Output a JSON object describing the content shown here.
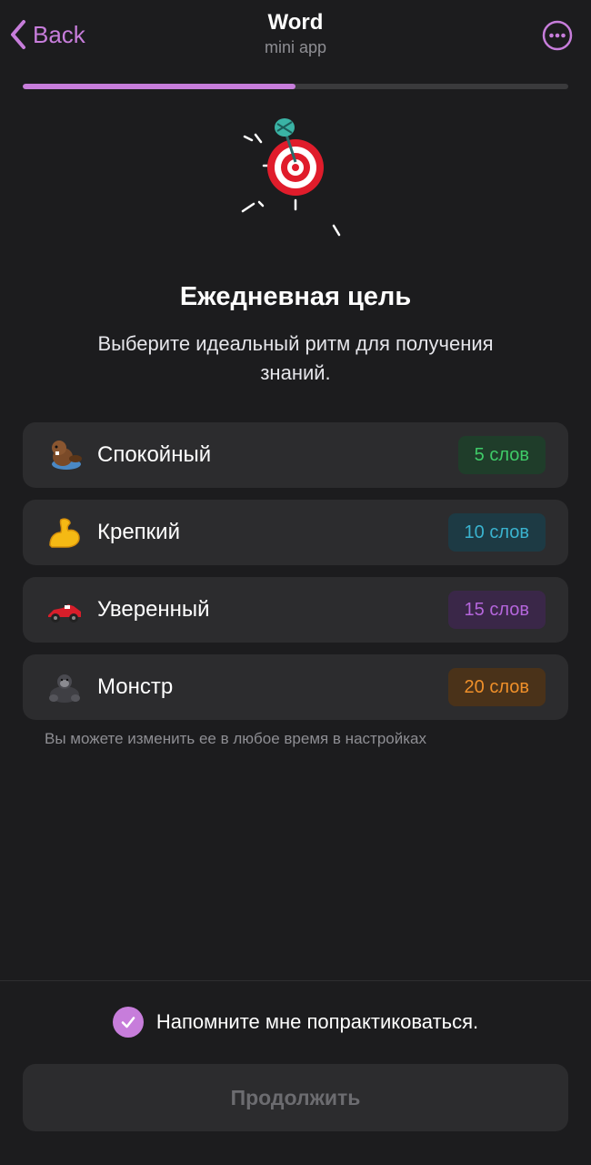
{
  "header": {
    "back_label": "Back",
    "title": "Word",
    "subtitle": "mini app"
  },
  "progress": {
    "fraction": 0.5
  },
  "colors": {
    "accent": "#c77ddb",
    "background": "#1c1c1e",
    "card": "#2c2c2e"
  },
  "main": {
    "heading": "Ежедневная цель",
    "subheading": "Выберите идеальный ритм для получения знаний.",
    "options": [
      {
        "icon": "beaver-icon",
        "label": "Спокойный",
        "badge": "5 слов",
        "color": "green"
      },
      {
        "icon": "flexed-biceps-icon",
        "label": "Крепкий",
        "badge": "10 слов",
        "color": "teal"
      },
      {
        "icon": "race-car-icon",
        "label": "Уверенный",
        "badge": "15 слов",
        "color": "purple"
      },
      {
        "icon": "gorilla-icon",
        "label": "Монстр",
        "badge": "20 слов",
        "color": "orange"
      }
    ],
    "hint": "Вы можете изменить ее в любое время в настройках"
  },
  "footer": {
    "remind_label": "Напомните мне попрактиковаться.",
    "remind_checked": true,
    "continue_label": "Продолжить"
  }
}
